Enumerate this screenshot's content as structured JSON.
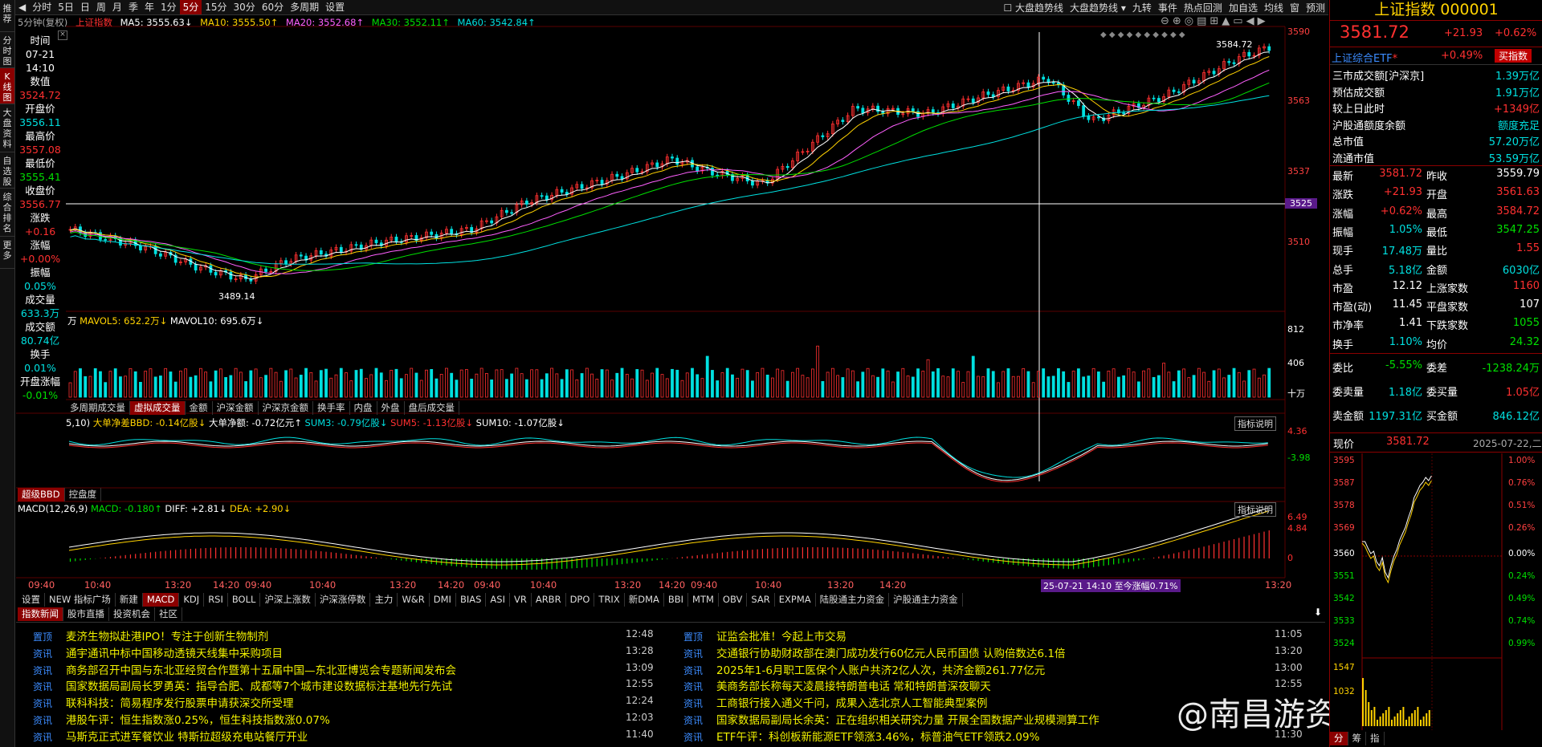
{
  "vtabs": [
    "推荐",
    "分时图",
    "K线图",
    "大盘资料",
    "自选股",
    "综合排名",
    "更多"
  ],
  "periods": [
    "分时",
    "5日",
    "日",
    "周",
    "月",
    "季",
    "年",
    "1分",
    "5分",
    "15分",
    "30分",
    "60分",
    "多周期",
    "设置"
  ],
  "period_active": "5分",
  "toolbar_right": [
    "大盘趋势线",
    "大盘趋势线 ▾",
    "九转",
    "事件",
    "热点回测",
    "加自选",
    "均线",
    "窗",
    "预测"
  ],
  "chart_header": {
    "label": "5分钟(复权)",
    "name": "上证指数",
    "ma5": "MA5: 3555.63↓",
    "ma10": "MA10: 3555.50↑",
    "ma20": "MA20: 3552.68↑",
    "ma30": "MA30: 3552.11↑",
    "ma60": "MA60: 3542.84↑"
  },
  "datacol": [
    {
      "label": "时间",
      "value": "07-21"
    },
    {
      "label": "",
      "value": "14:10"
    },
    {
      "label": "数值",
      "value": "3524.72"
    },
    {
      "label": "开盘价",
      "value": "3556.11"
    },
    {
      "label": "最高价",
      "value": "3557.08"
    },
    {
      "label": "最低价",
      "value": "3555.41"
    },
    {
      "label": "收盘价",
      "value": "3556.77"
    },
    {
      "label": "涨跌",
      "value": "+0.16"
    },
    {
      "label": "涨幅",
      "value": "+0.00%"
    },
    {
      "label": "振幅",
      "value": "0.05%"
    },
    {
      "label": "成交量",
      "value": "633.3万"
    },
    {
      "label": "成交额",
      "value": "80.74亿"
    },
    {
      "label": "换手",
      "value": "0.01%"
    },
    {
      "label": "开盘涨幅",
      "value": "-0.01%"
    }
  ],
  "price_axis": [
    "3590",
    "3563",
    "3537",
    "3525",
    "3510"
  ],
  "price_high_label": "3584.72",
  "price_low_label": "3489.14",
  "vol_header": {
    "unit": "万",
    "mavol5": "MAVOL5: 652.2万↓",
    "mavol10": "MAVOL10: 695.6万↓"
  },
  "vol_axis": [
    "812",
    "406",
    "十万"
  ],
  "vol_tabs": [
    "多周期成交量",
    "虚拟成交量",
    "金额",
    "沪深金额",
    "沪深京金额",
    "换手率",
    "内盘",
    "外盘",
    "盘后成交量"
  ],
  "vol_tab_active": "虚拟成交量",
  "bbd_header": {
    "params": "5,10)",
    "bbd": "大单净差BBD: -0.14亿股↓",
    "net": "大单净额: -0.72亿元↑",
    "sum3": "SUM3: -0.79亿股↓",
    "sum5": "SUM5: -1.13亿股↓",
    "sum10": "SUM10: -1.07亿股↓"
  },
  "bbd_axis": [
    "4.36",
    "-3.98"
  ],
  "bbd_tabs": [
    "超级BBD",
    "控盘度"
  ],
  "ind_btn": "指标说明",
  "macd_header": {
    "name": "MACD(12,26,9)",
    "macd": "MACD: -0.180↑",
    "diff": "DIFF: +2.81↓",
    "dea": "DEA: +2.90↓"
  },
  "macd_axis": [
    "6.49",
    "4.84",
    "0"
  ],
  "time_axis": [
    "09:40",
    "10:40",
    "13:20",
    "14:20",
    "09:40",
    "10:40",
    "13:20",
    "14:20",
    "09:40",
    "10:40",
    "13:20",
    "14:20",
    "09:40",
    "10:40",
    "13:20",
    "14:20",
    "10:40",
    "13:20"
  ],
  "crosshair_label": "25-07-21 14:10 至今涨幅0.71%",
  "crosshair_price": "3525",
  "indicator_tabs": [
    "设置",
    "NEW 指标广场",
    "新建",
    "MACD",
    "KDJ",
    "RSI",
    "BOLL",
    "沪深上涨数",
    "沪深涨停数",
    "主力",
    "W&R",
    "DMI",
    "BIAS",
    "ASI",
    "VR",
    "ARBR",
    "DPO",
    "TRIX",
    "新DMA",
    "BBI",
    "MTM",
    "OBV",
    "SAR",
    "EXPMA",
    "陆股通主力资金",
    "沪股通主力资金"
  ],
  "indicator_active": "MACD",
  "news_tabs": [
    "指数新闻",
    "股市直播",
    "投资机会",
    "社区"
  ],
  "news_left": [
    {
      "tag": "置顶",
      "title": "麦济生物拟赴港IPO！专注于创新生物制剂",
      "time": "12:48"
    },
    {
      "tag": "资讯",
      "title": "通宇通讯中标中国移动透镜天线集中采购项目",
      "time": "13:28"
    },
    {
      "tag": "资讯",
      "title": "商务部召开中国与东北亚经贸合作暨第十五届中国—东北亚博览会专题新闻发布会",
      "time": "13:09"
    },
    {
      "tag": "资讯",
      "title": "国家数据局副局长罗勇英：指导合肥、成都等7个城市建设数据标注基地先行先试",
      "time": "12:55"
    },
    {
      "tag": "资讯",
      "title": "联科科技：简易程序发行股票申请获深交所受理",
      "time": "12:24"
    },
    {
      "tag": "资讯",
      "title": "港股午评：恒生指数涨0.25%，恒生科技指数涨0.07%",
      "time": "12:03"
    },
    {
      "tag": "资讯",
      "title": "马斯克正式进军餐饮业 特斯拉超级充电站餐厅开业",
      "time": "11:40"
    }
  ],
  "news_right": [
    {
      "tag": "置顶",
      "title": "证监会批准！今起上市交易",
      "time": "11:05"
    },
    {
      "tag": "资讯",
      "title": "交通银行协助财政部在澳门成功发行60亿元人民币国债 认购倍数达6.1倍",
      "time": "13:20"
    },
    {
      "tag": "资讯",
      "title": "2025年1-6月职工医保个人账户共济2亿人次，共济金额261.77亿元",
      "time": "13:00"
    },
    {
      "tag": "资讯",
      "title": "美商务部长称每天凌晨接特朗普电话 常和特朗普深夜聊天",
      "time": "12:55"
    },
    {
      "tag": "资讯",
      "title": "工商银行接入通义千问，成果入选北京人工智能典型案例",
      "time": ""
    },
    {
      "tag": "资讯",
      "title": "国家数据局副局长余英：正在组织相关研究力量 开展全国数据产业规模测算工作",
      "time": ""
    },
    {
      "tag": "资讯",
      "title": "ETF午评：科创板新能源ETF领涨3.46%，标普油气ETF领跌2.09%",
      "time": "11:30"
    }
  ],
  "watermark": "@南昌游资-谢老",
  "right_panel": {
    "title": "上证指数 000001",
    "price": "3581.72",
    "change": "+21.93",
    "pct": "+0.62%",
    "etf_name": "上证综合ETF",
    "etf_pct": "+0.49%",
    "etf_btn": "买指数",
    "stats1": [
      {
        "k": "三市成交额[沪深京]",
        "v": "1.39万亿",
        "c": "cyan"
      },
      {
        "k": "预估成交额",
        "v": "1.91万亿",
        "c": "cyan"
      },
      {
        "k": "较上日此时",
        "v": "+1349亿",
        "c": "red"
      },
      {
        "k": "沪股通额度余额",
        "v": "额度充足",
        "c": "cyan"
      },
      {
        "k": "总市值",
        "v": "57.20万亿",
        "c": "cyan"
      },
      {
        "k": "流通市值",
        "v": "53.59万亿",
        "c": "cyan"
      }
    ],
    "quote": [
      {
        "k1": "最新",
        "v1": "3581.72",
        "c1": "red",
        "k2": "昨收",
        "v2": "3559.79",
        "c2": "white"
      },
      {
        "k1": "涨跌",
        "v1": "+21.93",
        "c1": "red",
        "k2": "开盘",
        "v2": "3561.63",
        "c2": "red"
      },
      {
        "k1": "涨幅",
        "v1": "+0.62%",
        "c1": "red",
        "k2": "最高",
        "v2": "3584.72",
        "c2": "red"
      },
      {
        "k1": "振幅",
        "v1": "1.05%",
        "c1": "cyan",
        "k2": "最低",
        "v2": "3547.25",
        "c2": "green"
      },
      {
        "k1": "现手",
        "v1": "17.48万",
        "c1": "cyan",
        "k2": "量比",
        "v2": "1.55",
        "c2": "red"
      },
      {
        "k1": "总手",
        "v1": "5.18亿",
        "c1": "cyan",
        "k2": "金额",
        "v2": "6030亿",
        "c2": "cyan"
      },
      {
        "k1": "市盈",
        "v1": "12.12",
        "c1": "white",
        "k2": "上涨家数",
        "v2": "1160",
        "c2": "red"
      },
      {
        "k1": "市盈(动)",
        "v1": "11.45",
        "c1": "white",
        "k2": "平盘家数",
        "v2": "107",
        "c2": "white"
      },
      {
        "k1": "市净率",
        "v1": "1.41",
        "c1": "white",
        "k2": "下跌家数",
        "v2": "1055",
        "c2": "green"
      },
      {
        "k1": "换手",
        "v1": "1.10%",
        "c1": "cyan",
        "k2": "均价",
        "v2": "24.32",
        "c2": "green"
      }
    ],
    "quote2": [
      {
        "k1": "委比",
        "v1": "-5.55%",
        "c1": "green",
        "k2": "委差",
        "v2": "-1238.24万",
        "c2": "green"
      },
      {
        "k1": "委卖量",
        "v1": "1.18亿",
        "c1": "cyan",
        "k2": "委买量",
        "v2": "1.05亿",
        "c2": "red"
      },
      {
        "k1": "卖金额",
        "v1": "1197.31亿",
        "c1": "cyan",
        "k2": "买金额",
        "v2": "846.12亿",
        "c2": "cyan"
      }
    ],
    "now_label": "现价",
    "now_value": "3581.72",
    "date": "2025-07-22,二",
    "mini_axis_left": [
      "3595",
      "3587",
      "3578",
      "3569",
      "3560",
      "3551",
      "3542",
      "3533",
      "3524",
      "1547",
      "1032"
    ],
    "mini_axis_right": [
      "1.00%",
      "0.76%",
      "0.51%",
      "0.26%",
      "0.00%",
      "0.24%",
      "0.49%",
      "0.74%",
      "0.99%"
    ],
    "bottom_tabs": [
      "分",
      "筹",
      "指"
    ]
  }
}
